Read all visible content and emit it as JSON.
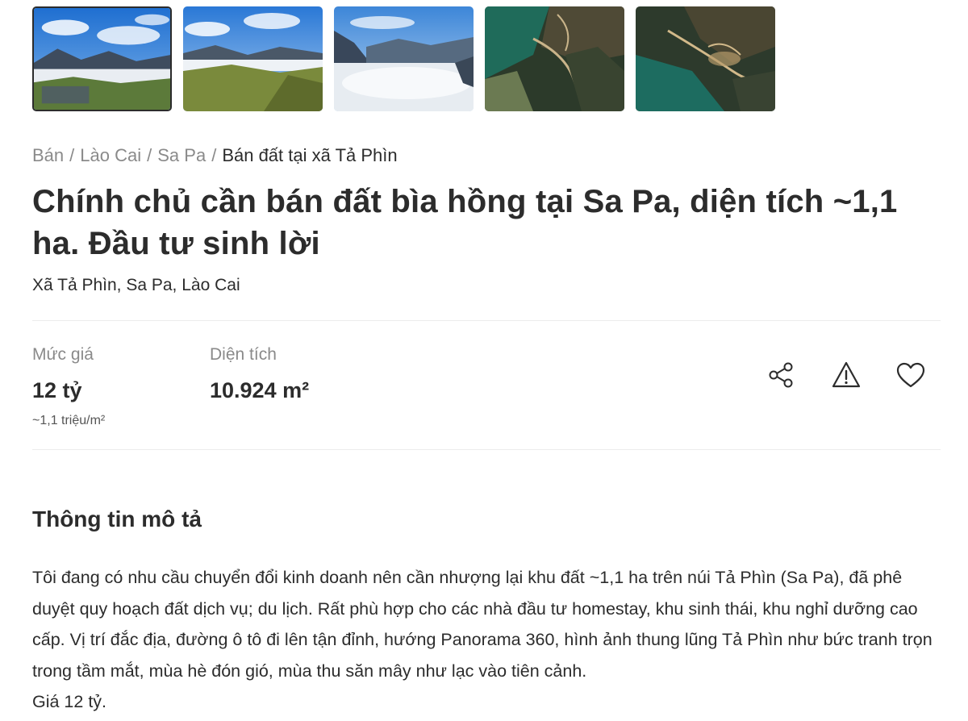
{
  "gallery": {
    "images": [
      {
        "name": "mountain-valley-photo-1",
        "active": true
      },
      {
        "name": "mountain-valley-photo-2",
        "active": false
      },
      {
        "name": "cloud-sea-photo",
        "active": false
      },
      {
        "name": "satellite-map-photo-1",
        "active": false
      },
      {
        "name": "satellite-map-photo-2",
        "active": false
      }
    ]
  },
  "breadcrumb": {
    "items": [
      "Bán",
      "Lào Cai",
      "Sa Pa"
    ],
    "current": "Bán đất tại xã Tả Phìn",
    "separator": "/"
  },
  "listing": {
    "title": "Chính chủ cần bán đất bìa hồng tại Sa Pa, diện tích ~1,1 ha. Đầu tư sinh lời",
    "address": "Xã Tả Phìn, Sa Pa, Lào Cai"
  },
  "stats": {
    "price_label": "Mức giá",
    "price_value": "12 tỷ",
    "price_per_m2": "~1,1 triệu/m²",
    "area_label": "Diện tích",
    "area_value": "10.924 m²"
  },
  "actions": {
    "icons": [
      "share-icon",
      "warning-icon",
      "heart-icon"
    ]
  },
  "description": {
    "heading": "Thông tin mô tả",
    "paragraph": "Tôi đang có nhu cầu chuyển đổi kinh doanh nên cần nhượng lại khu đất ~1,1 ha trên núi Tả Phìn (Sa Pa), đã phê duyệt quy hoạch đất dịch vụ; du lịch. Rất phù hợp cho các nhà đầu tư homestay, khu sinh thái, khu nghỉ dưỡng cao cấp. Vị trí đắc địa, đường ô tô đi lên tận đỉnh, hướng Panorama 360, hình ảnh thung lũng Tả Phìn như bức tranh trọn trong tầm mắt, mùa hè đón gió, mùa thu săn mây như lạc vào tiên cảnh.",
    "price_line": "Giá 12 tỷ."
  },
  "colors": {
    "text": "#2c2c2c",
    "muted": "#8a8a8a",
    "divider": "#ececec"
  }
}
